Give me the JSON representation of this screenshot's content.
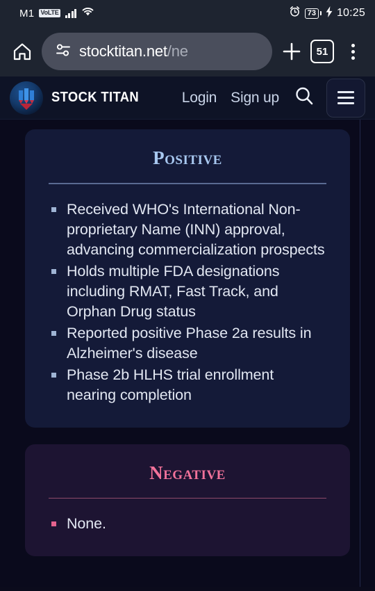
{
  "statusbar": {
    "carrier": "M1",
    "network_badge": "VoLTE",
    "signal_icon": "signal-bars-icon",
    "wifi_icon": "wifi-icon",
    "alarm_icon": "alarm-clock-icon",
    "battery_level": "73",
    "charging_icon": "charging-bolt-icon",
    "time": "10:25"
  },
  "browser": {
    "home_icon": "home-icon",
    "site_settings_icon": "site-settings-tune-icon",
    "url_visible": "stocktitan.net",
    "url_dim": "/ne",
    "url_full": "stocktitan.net/ne",
    "new_tab_icon": "plus-icon",
    "tab_count": "51",
    "menu_icon": "three-dot-menu-icon"
  },
  "site_header": {
    "logo_icon": "stock-titan-logo-icon",
    "brand": "STOCK TITAN",
    "login_label": "Login",
    "signup_label": "Sign up",
    "search_icon": "search-icon",
    "menu_icon": "hamburger-menu-icon"
  },
  "main": {
    "cards": [
      {
        "title": "Positive",
        "accent": "#a8c8f0",
        "points": [
          "Received WHO's International Non-proprietary Name (INN) approval, advancing commercialization prospects",
          "Holds multiple FDA designations including RMAT, Fast Track, and Orphan Drug status",
          "Reported positive Phase 2a results in Alzheimer's disease",
          "Phase 2b HLHS trial enrollment nearing completion"
        ]
      },
      {
        "title": "Negative",
        "accent": "#f2729a",
        "points": [
          "None."
        ]
      }
    ]
  }
}
